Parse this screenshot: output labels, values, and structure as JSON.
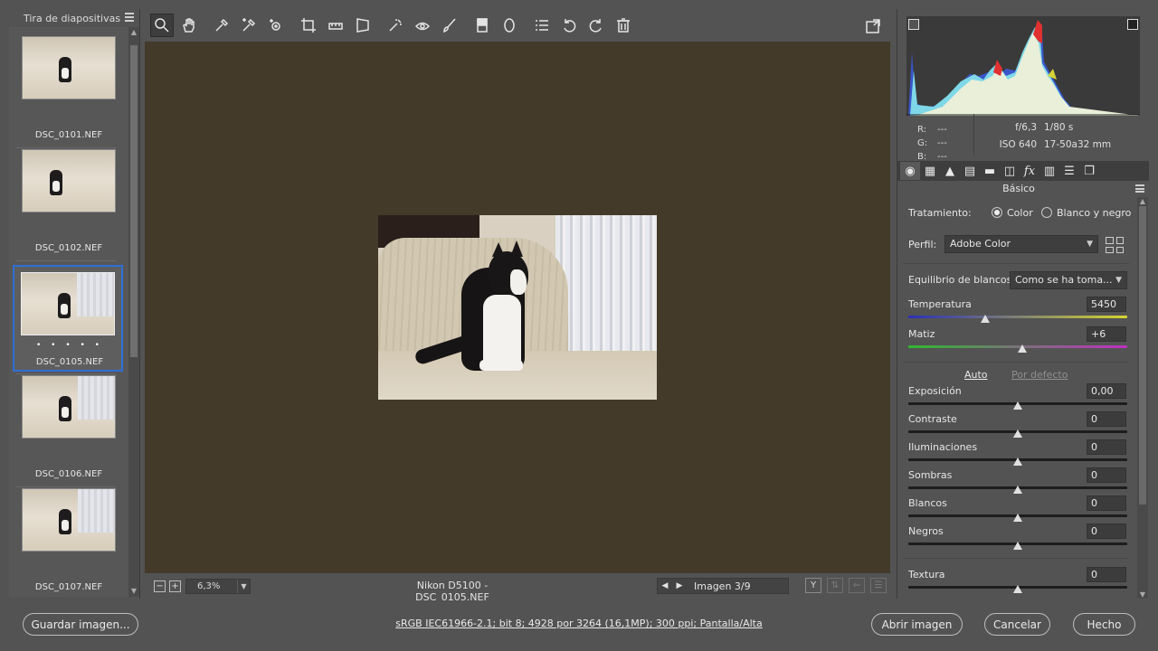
{
  "filmstrip": {
    "title": "Tira de diapositivas",
    "items": [
      {
        "name": "DSC_0101.NEF"
      },
      {
        "name": "DSC_0102.NEF"
      },
      {
        "name": "DSC_0105.NEF",
        "selected": true,
        "rating_dots": "• • • • •"
      },
      {
        "name": "DSC_0106.NEF"
      },
      {
        "name": "DSC_0107.NEF"
      }
    ]
  },
  "toolbar": {
    "tools": [
      "zoom-icon",
      "hand-icon",
      "white-balance-icon",
      "color-sampler-icon",
      "target-adjust-icon",
      "crop-icon",
      "straighten-icon",
      "transform-icon",
      "spot-removal-icon",
      "red-eye-icon",
      "adjustment-brush-icon",
      "graduated-filter-icon",
      "radial-filter-icon",
      "presets-list-icon",
      "rotate-left-icon",
      "rotate-right-icon",
      "delete-icon"
    ],
    "fullscreen_icon": "fullscreen-icon"
  },
  "status": {
    "zoom": "6,3%",
    "camera": "Nikon D5100 -  DSC_0105.NEF",
    "image_counter": "Imagen 3/9"
  },
  "histogram": {
    "rgb": {
      "r": "---",
      "g": "---",
      "b": "---"
    },
    "labels": {
      "r": "R:",
      "g": "G:",
      "b": "B:"
    },
    "aperture": "f/6,3",
    "shutter": "1/80 s",
    "iso": "ISO 640",
    "lens": "17-50a32 mm"
  },
  "panel": {
    "section_title": "Básico",
    "treatment_label": "Tratamiento:",
    "treatment_color": "Color",
    "treatment_bw": "Blanco y negro",
    "profile_label": "Perfil:",
    "profile_value": "Adobe Color",
    "wb_label": "Equilibrio de blancos:",
    "wb_value": "Como se ha toma...",
    "auto": "Auto",
    "default": "Por defecto",
    "sliders": {
      "temperature": {
        "label": "Temperatura",
        "value": "5450",
        "position": 0.35
      },
      "tint": {
        "label": "Matiz",
        "value": "+6",
        "position": 0.52
      },
      "exposure": {
        "label": "Exposición",
        "value": "0,00",
        "position": 0.5
      },
      "contrast": {
        "label": "Contraste",
        "value": "0",
        "position": 0.5
      },
      "highlights": {
        "label": "Iluminaciones",
        "value": "0",
        "position": 0.5
      },
      "shadows": {
        "label": "Sombras",
        "value": "0",
        "position": 0.5
      },
      "whites": {
        "label": "Blancos",
        "value": "0",
        "position": 0.5
      },
      "blacks": {
        "label": "Negros",
        "value": "0",
        "position": 0.5
      },
      "texture": {
        "label": "Textura",
        "value": "0",
        "position": 0.5
      }
    }
  },
  "bottom": {
    "save": "Guardar imagen...",
    "info_link": "sRGB IEC61966-2.1; bit 8; 4928 por 3264 (16,1MP); 300 ppi; Pantalla/Alta",
    "open": "Abrir imagen",
    "cancel": "Cancelar",
    "done": "Hecho"
  }
}
